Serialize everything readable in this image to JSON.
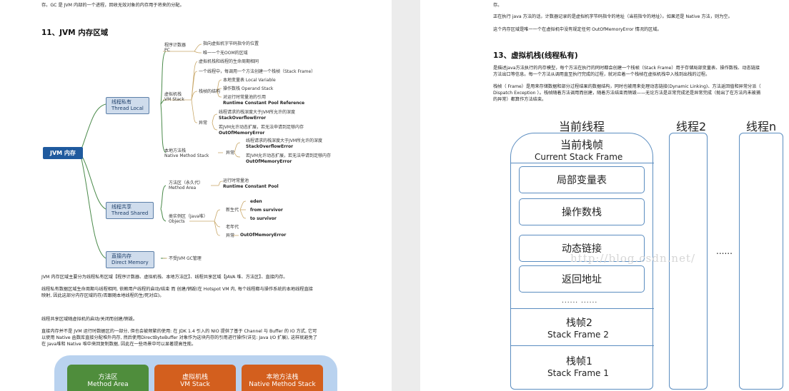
{
  "left": {
    "top_text": "存。GC 是 JVM 内部的一个进程，回收无效对象的内存用于将来的分配。",
    "heading": "11、JVM 内存区域",
    "mindmap": {
      "root": "JVM 内存",
      "thread_local": "线程私有\nThread Local",
      "thread_shared": "线程共享\nThread Shared",
      "direct": "直接内存\nDirect Memory",
      "pc": "程序计数器\nPC",
      "pc_1": "指向虚拟机字节码指令的位置",
      "pc_2": "唯一一个无OOM的区域",
      "vms": "虚拟机栈\nVM Stack",
      "vms_1": "虚拟机栈和线程的生命周期相同",
      "vms_2": "一个线程中，每调用一个方法创建一个栈帧（Stack Frame）",
      "frame": "栈帧的结构",
      "frame_1": "本地变量表 Local Variable",
      "frame_2": "操作数栈 Operand Stack",
      "frame_3a": "对运行时常量池的引用",
      "frame_3b": "Runtime Constant Pool Reference",
      "exc": "异常",
      "exc_1a": "线程请求的栈深度大于JVM所允许的深度",
      "exc_1b": "StackOverflowError",
      "exc_2a": "若JVM允许动态扩展，若无法申请到足够内存",
      "exc_2b": "OutOfMemoryError",
      "nms": "本地方法栈\nNative Method Stack",
      "nexc": "异常",
      "nexc_1a": "线程请求的栈深度大于JVM所允许的深度",
      "nexc_1b": "StackOverflowError",
      "nexc_2a": "若JVM允许动态扩展，若无法申请到足够内存",
      "nexc_2b": "OutOfMemoryError",
      "ma": "方法区（永久代）\nMethod Area",
      "ma_1a": "运行时常量池",
      "ma_1b": "Runtime Constant Pool",
      "obj": "类实例区（Java堆）\nObjects",
      "young": "新生代",
      "eden": "eden",
      "from": "from survivor",
      "to": "to survivor",
      "old": "老年代",
      "oexc": "异常",
      "oexc_1": "OutOfMemoryError",
      "direct_1": "不受JVM GC管理"
    },
    "para1": "JVM 内存区域主要分为线程私有区域【程序计数器、虚拟机栈、本地方法区】、线程共享区域【JAVA 堆、方法区】、直接内存。",
    "para2a": "线程私有数据区域生命周期与线程相同, 依赖用户线程的启动/结束 而 创建/销毁(在 Hotspot VM 内, 每个线程都与操作系统的本地线程直接",
    "para2b": "映射, 因此这部分内存区域的存/否跟随本地线程的生/死对应)。",
    "para3": "线程共享区域随虚拟机的启动/关闭而创建/销毁。",
    "para4a": "直接内存并不是 JVM 运行时数据区的一部分, 但也会被频繁的使用: 在 JDK 1.4 引入的 NIO 提供了基于 Channel 与 Buffer 的 IO 方式, 它可",
    "para4b": "以使用 Native 函数库直接分配堆外内存, 然后使用DirectByteBuffer 对象作为这块内存的引用进行操作(详见: Java I/O 扩展), 这样就避免了",
    "para4c": "在 Java堆和 Native 堆中来回复制数据, 因此在一些场景中可以显著提高性能。",
    "mem_method": "方法区",
    "mem_method_sub": "Method Area",
    "mem_vm": "虚拟机栈",
    "mem_vm_sub": "VM Stack",
    "mem_native": "本地方法栈",
    "mem_native_sub": "Native Method Stack"
  },
  "right": {
    "top_text": "存。",
    "line1": "正在执行 java 方法的话，计数器记录的是虚拟机字节码指令的地址（当前指令的地址）。如果还是 Native 方法，则为空。",
    "line2": "这个内存区域是唯一一个在虚拟机中没有规定任何 OutOfMemoryError 情况的区域。",
    "heading": "13、虚拟机栈(线程私有)",
    "para1a": "是描述java方法执行的内存模型，每个方法在执行的同时都会创建一个栈帧（Stack Frame）用于存储局部变量表、操作数栈、动态链接",
    "para1b": "方法出口等信息。每一个方法从调用直至执行完成的过程，就对应着一个栈帧在虚拟机栈中入栈到出栈的过程。",
    "para2a": "栈帧（ Frame）是用来存储数据和部分过程结果的数据结构，同时也被用来处理动态链接(Dynamic Linking)、方法返回值和异常分派（",
    "para2b": "Dispatch Exception ）。栈帧随着方法调用而创建，随着方法结束而销毁——无论方法是正常完成还是异常完成（抛出了在方法内未被捕",
    "para2c": "的异常）都算作方法结束。",
    "current_thread": "当前线程",
    "thread2": "线程2",
    "threadn": "线程n",
    "current_frame": "当前栈帧",
    "current_frame_en": "Current Stack Frame",
    "local_vars": "局部变量表",
    "operand_stack": "操作数栈",
    "dynamic_link": "动态链接",
    "return_addr": "返回地址",
    "dots_small": "...... ......",
    "dots_side": "......",
    "frame2": "栈帧2",
    "frame2_en": "Stack Frame 2",
    "frame1": "栈帧1",
    "frame1_en": "Stack Frame 1",
    "watermark": "http://blog.csdn.net/"
  },
  "colors": {
    "method_green": "#4f8d3c",
    "vm_orange": "#d35f1e",
    "frame_blue": "#5b8dc0",
    "node_blue": "#1f5a9e"
  }
}
